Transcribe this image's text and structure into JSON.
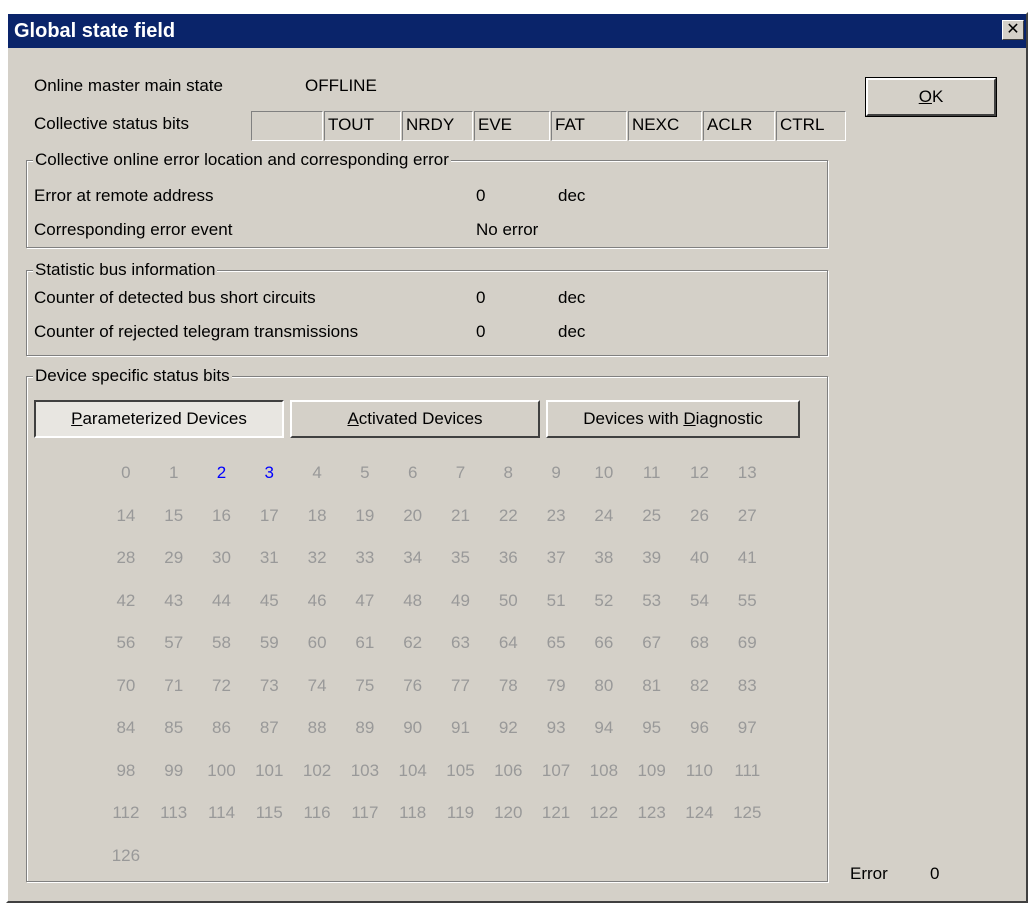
{
  "window": {
    "title": "Global state field",
    "close_label": "✕"
  },
  "ok_button": {
    "prefix": "O",
    "rest": "K"
  },
  "online_master": {
    "label": "Online master main state",
    "value": "OFFLINE"
  },
  "collective_status": {
    "label": "Collective status bits",
    "bits": [
      "",
      "TOUT",
      "NRDY",
      "EVE",
      "FAT",
      "NEXC",
      "ACLR",
      "CTRL"
    ]
  },
  "error_group": {
    "title": "Collective online error location and corresponding error",
    "remote_address_label": "Error at remote address",
    "remote_address_value": "0",
    "remote_address_unit": "dec",
    "event_label": "Corresponding error event",
    "event_value": "No error"
  },
  "statistic_group": {
    "title": "Statistic bus information",
    "short_label": "Counter of detected bus short circuits",
    "short_value": "0",
    "short_unit": "dec",
    "rejected_label": "Counter of rejected telegram transmissions",
    "rejected_value": "0",
    "rejected_unit": "dec"
  },
  "device_group": {
    "title": "Device specific status bits",
    "buttons": [
      {
        "pre": "",
        "key": "P",
        "post": "arameterized Devices"
      },
      {
        "pre": "",
        "key": "A",
        "post": "ctivated Devices"
      },
      {
        "pre": "Devices with ",
        "key": "D",
        "post": "iagnostic"
      }
    ],
    "active_devices": [
      2,
      3
    ],
    "device_count": 127,
    "inactive_color": "#999999",
    "active_color": "#0000ff"
  },
  "footer": {
    "error_label": "Error",
    "error_value": "0"
  }
}
